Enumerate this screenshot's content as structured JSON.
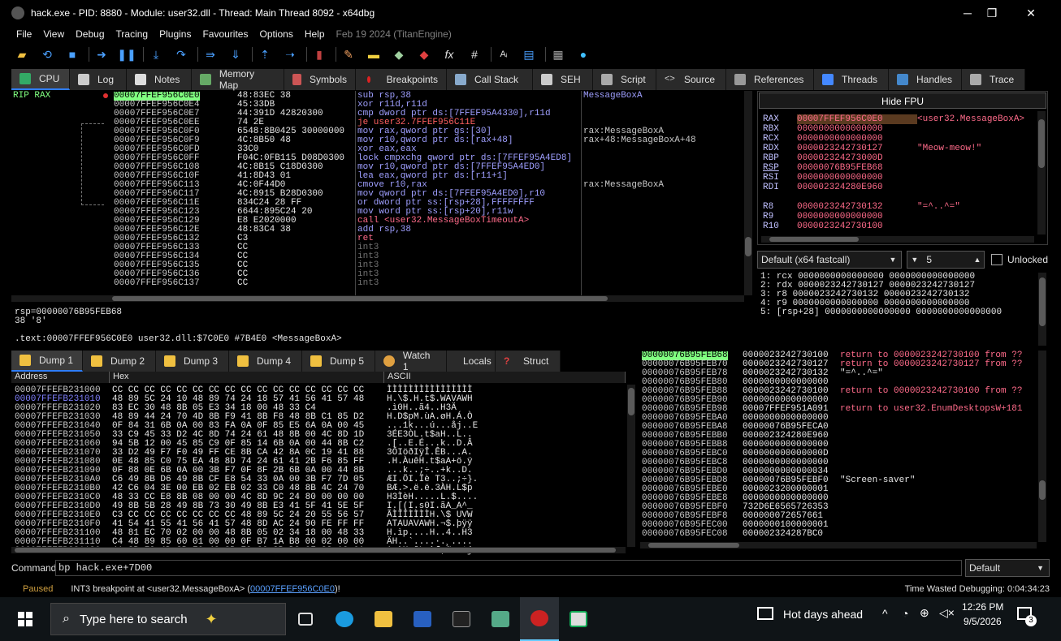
{
  "window": {
    "title": "hack.exe - PID: 8880 - Module: user32.dll - Thread: Main Thread 8092 - x64dbg",
    "minimize": "─",
    "maximize": "❐",
    "close": "✕"
  },
  "menu": [
    "File",
    "View",
    "Debug",
    "Tracing",
    "Plugins",
    "Favourites",
    "Options",
    "Help"
  ],
  "menu_date": "Feb 19 2024 (TitanEngine)",
  "toolbar_icons": [
    "open-icon",
    "restart-icon",
    "stop-icon",
    "run-icon",
    "pause-icon",
    "step-into-icon",
    "step-over-icon",
    "trace-into-icon",
    "trace-over-icon",
    "execute-till-return-icon",
    "run-to-user-code-icon",
    "patch-icon",
    "comment-icon",
    "label-icon",
    "bookmark-icon",
    "function-icon",
    "hash-icon",
    "font-icon",
    "settings-icon",
    "calculator-icon",
    "globe-icon"
  ],
  "tabs": [
    {
      "label": "CPU",
      "icon": "cpu-icon",
      "active": true
    },
    {
      "label": "Log",
      "icon": "log-icon"
    },
    {
      "label": "Notes",
      "icon": "notes-icon"
    },
    {
      "label": "Memory Map",
      "icon": "memory-map-icon"
    },
    {
      "label": "Symbols",
      "icon": "symbols-icon"
    },
    {
      "label": "Breakpoints",
      "icon": "breakpoints-icon"
    },
    {
      "label": "Call Stack",
      "icon": "call-stack-icon"
    },
    {
      "label": "SEH",
      "icon": "seh-icon"
    },
    {
      "label": "Script",
      "icon": "script-icon"
    },
    {
      "label": "Source",
      "icon": "source-icon"
    },
    {
      "label": "References",
      "icon": "references-icon"
    },
    {
      "label": "Threads",
      "icon": "threads-icon"
    },
    {
      "label": "Handles",
      "icon": "handles-icon"
    },
    {
      "label": "Trace",
      "icon": "trace-icon"
    }
  ],
  "disasm": {
    "rip_label": "RIP RAX",
    "rows": [
      {
        "addr": "00007FFEF956C0E0",
        "bytes": "48:83EC 38",
        "ins": "sub rsp,38",
        "cmt": "MessageBoxA",
        "current": true
      },
      {
        "addr": "00007FFEF956C0E4",
        "bytes": "45:33DB",
        "ins": "xor r11d,r11d",
        "cmt": ""
      },
      {
        "addr": "00007FFEF956C0E7",
        "bytes": "44:391D 42820300",
        "ins": "cmp dword ptr ds:[7FFEF95A4330],r11d",
        "cmt": ""
      },
      {
        "addr": "00007FFEF956C0EE",
        "bytes": "74 2E",
        "ins": "je user32.7FFEF956C11E",
        "cmt": "",
        "jmp": true
      },
      {
        "addr": "00007FFEF956C0F0",
        "bytes": "6548:8B0425 30000000",
        "ins": "mov rax,qword ptr gs:[30]",
        "cmt": "rax:MessageBoxA"
      },
      {
        "addr": "00007FFEF956C0F9",
        "bytes": "4C:8B50 48",
        "ins": "mov r10,qword ptr ds:[rax+48]",
        "cmt": "rax+48:MessageBoxA+48"
      },
      {
        "addr": "00007FFEF956C0FD",
        "bytes": "33C0",
        "ins": "xor eax,eax",
        "cmt": ""
      },
      {
        "addr": "00007FFEF956C0FF",
        "bytes": "F04C:0FB115 D08D0300",
        "ins": "lock cmpxchg qword ptr ds:[7FFEF95A4ED8]",
        "cmt": ""
      },
      {
        "addr": "00007FFEF956C108",
        "bytes": "4C:8B15 C18D0300",
        "ins": "mov r10,qword ptr ds:[7FFEF95A4ED0]",
        "cmt": ""
      },
      {
        "addr": "00007FFEF956C10F",
        "bytes": "41:8D43 01",
        "ins": "lea eax,qword ptr ds:[r11+1]",
        "cmt": ""
      },
      {
        "addr": "00007FFEF956C113",
        "bytes": "4C:0F44D0",
        "ins": "cmove r10,rax",
        "cmt": "rax:MessageBoxA"
      },
      {
        "addr": "00007FFEF956C117",
        "bytes": "4C:8915 B28D0300",
        "ins": "mov qword ptr ds:[7FFEF95A4ED0],r10",
        "cmt": ""
      },
      {
        "addr": "00007FFEF956C11E",
        "bytes": "834C24 28 FF",
        "ins": "or dword ptr ss:[rsp+28],FFFFFFFF",
        "cmt": ""
      },
      {
        "addr": "00007FFEF956C123",
        "bytes": "6644:895C24 20",
        "ins": "mov word ptr ss:[rsp+20],r11w",
        "cmt": ""
      },
      {
        "addr": "00007FFEF956C129",
        "bytes": "E8 E2020000",
        "ins": "call <user32.MessageBoxTimeoutA>",
        "cmt": "",
        "call": true
      },
      {
        "addr": "00007FFEF956C12E",
        "bytes": "48:83C4 38",
        "ins": "add rsp,38",
        "cmt": ""
      },
      {
        "addr": "00007FFEF956C132",
        "bytes": "C3",
        "ins": "ret",
        "cmt": "",
        "ret": true
      },
      {
        "addr": "00007FFEF956C133",
        "bytes": "CC",
        "ins": "int3",
        "cmt": "",
        "pad": true
      },
      {
        "addr": "00007FFEF956C134",
        "bytes": "CC",
        "ins": "int3",
        "cmt": "",
        "pad": true
      },
      {
        "addr": "00007FFEF956C135",
        "bytes": "CC",
        "ins": "int3",
        "cmt": "",
        "pad": true
      },
      {
        "addr": "00007FFEF956C136",
        "bytes": "CC",
        "ins": "int3",
        "cmt": "",
        "pad": true
      },
      {
        "addr": "00007FFEF956C137",
        "bytes": "CC",
        "ins": "int3",
        "cmt": "",
        "pad": true
      }
    ]
  },
  "info": {
    "line1": "rsp=00000076B95FEB68",
    "line2": "38 '8'",
    "line3": ".text:00007FFEF956C0E0 user32.dll:$7C0E0 #7B4E0 <MessageBoxA>"
  },
  "registers": {
    "hide_fpu": "Hide FPU",
    "rows": [
      {
        "name": "RAX",
        "value": "00007FFEF956C0E0",
        "cmt": "<user32.MessageBoxA>",
        "hl": true
      },
      {
        "name": "RBX",
        "value": "0000000000000000",
        "cmt": ""
      },
      {
        "name": "RCX",
        "value": "0000000000000000",
        "cmt": ""
      },
      {
        "name": "RDX",
        "value": "0000023242730127",
        "cmt": "\"Meow-meow!\""
      },
      {
        "name": "RBP",
        "value": "000002324273000D",
        "cmt": ""
      },
      {
        "name": "RSP",
        "value": "00000076B95FEB68",
        "cmt": ""
      },
      {
        "name": "RSI",
        "value": "0000000000000000",
        "cmt": ""
      },
      {
        "name": "RDI",
        "value": "000002324280E960",
        "cmt": ""
      },
      {
        "name": "R8",
        "value": "0000023242730132",
        "cmt": "\"=^..^=\""
      },
      {
        "name": "R9",
        "value": "0000000000000000",
        "cmt": ""
      },
      {
        "name": "R10",
        "value": "0000023242730100",
        "cmt": ""
      }
    ]
  },
  "callconv": {
    "convention": "Default (x64 fastcall)",
    "count": "5",
    "unlocked": "Unlocked"
  },
  "stack_args": [
    "1: rcx 0000000000000000 0000000000000000",
    "2: rdx 0000023242730127 0000023242730127",
    "3: r8 0000023242730132 0000023242730132",
    "4: r9 0000000000000000 0000000000000000",
    "5: [rsp+28] 0000000000000000 0000000000000000"
  ],
  "dump_tabs": [
    "Dump 1",
    "Dump 2",
    "Dump 3",
    "Dump 4",
    "Dump 5",
    "Watch 1",
    "Locals",
    "Struct"
  ],
  "dump": {
    "headers": [
      "Address",
      "Hex",
      "ASCII"
    ],
    "rows": [
      {
        "addr": "00007FFEFB231000",
        "hex": "CC CC CC CC CC CC CC CC CC CC CC CC CC CC CC CC",
        "ascii": "ÌÌÌÌÌÌÌÌÌÌÌÌÌÌÌÌ"
      },
      {
        "addr": "00007FFEFB231010",
        "hex": "48 89 5C 24 10 48 89 74 24 18 57 41 56 41 57 48",
        "ascii": "H.\\$.H.t$.WAVAWH"
      },
      {
        "addr": "00007FFEFB231020",
        "hex": "83 EC 30 48 8B 05 E3 34 18 00 48 33 C4",
        "ascii": ".ì0H..ã4..H3Ä"
      },
      {
        "addr": "00007FFEFB231030",
        "hex": "48 89 44 24 70 4D 8B F9 41 8B F8 48 8B C1 85 D2",
        "ascii": "H.D$pM.ùA.øH.Á.Ò"
      },
      {
        "addr": "00007FFEFB231040",
        "hex": "0F 84 31 6B 0A 00 83 FA 0A 0F 85 E5 6A 0A 00 45",
        "ascii": "...1k...ú...åj..E"
      },
      {
        "addr": "00007FFEFB231050",
        "hex": "33 C9 45 33 D2 4C 8D 74 24 61 48 8B 00 4C 8D 1D",
        "ascii": "3ÉE3ÒL.t$aH..L.."
      },
      {
        "addr": "00007FFEFB231060",
        "hex": "94 5B 12 00 45 85 C9 0F 85 14 6B 0A 00 44 8B C2",
        "ascii": ".[..E.É...k..D.Â"
      },
      {
        "addr": "00007FFEFB231070",
        "hex": "33 D2 49 F7 F0 49 FF CE 8B CA 42 8A 0C 19 41 88",
        "ascii": "3ÒIöðIÿÎ.ÊB...A."
      },
      {
        "addr": "00007FFEFB231080",
        "hex": "0E 48 85 C0 75 EA 48 8D 74 24 61 41 2B F6 85 FF",
        "ascii": ".H.ÀuêH.t$aA+ö.ÿ"
      },
      {
        "addr": "00007FFEFB231090",
        "hex": "0F 88 0E 6B 0A 00 3B F7 0F 8F 2B 6B 0A 00 44 8B",
        "ascii": "...k..;÷..+k..D."
      },
      {
        "addr": "00007FFEFB2310A0",
        "hex": "C6 49 8B D6 49 8B CF E8 54 33 0A 00 3B F7 7D 05",
        "ascii": "ÆI.ÖI.Ïè T3..;÷}."
      },
      {
        "addr": "00007FFEFB2310B0",
        "hex": "42 C6 04 3E 00 EB 02 EB 02 33 C0 48 8B 4C 24 70",
        "ascii": "BÆ.>.ë.ë.3ÀH.L$p"
      },
      {
        "addr": "00007FFEFB2310C0",
        "hex": "48 33 CC E8 8B 08 00 00 4C 8D 9C 24 80 00 00 00",
        "ascii": "H3ÌèH.....L.$...."
      },
      {
        "addr": "00007FFEFB2310D0",
        "hex": "49 8B 5B 28 49 8B 73 30 49 8B E3 41 5F 41 5E 5F",
        "ascii": "I.[(I.s0I.ãA_A^_"
      },
      {
        "addr": "00007FFEFB2310E0",
        "hex": "C3 CC CC CC CC CC CC CC 48 89 5C 24 20 55 56 57",
        "ascii": "ÃÌÌÌÌÌÌÌH.\\$ UVW"
      },
      {
        "addr": "00007FFEFB2310F0",
        "hex": "41 54 41 55 41 56 41 57 48 8D AC 24 90 FE FF FF",
        "ascii": "ATAUAVAWH.¬$.þÿÿ"
      },
      {
        "addr": "00007FFEFB231100",
        "hex": "48 81 EC 70 02 00 00 48 8B 05 02 34 18 00 48 33",
        "ascii": "H.ìp....H..4..H3"
      },
      {
        "addr": "00007FFEFB231110",
        "hex": "C4 48 89 85 60 01 00 00 0F B7 1A B8 00 02 00 00",
        "ascii": "ÄH..`....·.¸...."
      },
      {
        "addr": "00007FFEFB231120",
        "hex": "41 8B F9 4D 8B F0 4C 8B F9 66 3B D8 0F 83 A2 6A",
        "ascii": "A.ùM.ðL.ùf;Ø..¢j"
      }
    ]
  },
  "stack": {
    "rows": [
      {
        "addr": "00000076B95FEB68",
        "val": "0000023242730100",
        "cmt": "return to 0000023242730100 from ??",
        "cur": true
      },
      {
        "addr": "00000076B95FEB70",
        "val": "0000023242730127",
        "cmt": "return to 0000023242730127 from ??"
      },
      {
        "addr": "00000076B95FEB78",
        "val": "0000023242730132",
        "cmt": "\"=^..^=\"",
        "str": true
      },
      {
        "addr": "00000076B95FEB80",
        "val": "0000000000000000",
        "cmt": ""
      },
      {
        "addr": "00000076B95FEB88",
        "val": "0000023242730100",
        "cmt": "return to 0000023242730100 from ??"
      },
      {
        "addr": "00000076B95FEB90",
        "val": "0000000000000000",
        "cmt": ""
      },
      {
        "addr": "00000076B95FEB98",
        "val": "00007FFEF951A091",
        "cmt": "return to user32.EnumDesktopsW+181"
      },
      {
        "addr": "00000076B95FEBA0",
        "val": "0000000000000000",
        "cmt": ""
      },
      {
        "addr": "00000076B95FEBA8",
        "val": "00000076B95FECA0",
        "cmt": ""
      },
      {
        "addr": "00000076B95FEBB0",
        "val": "000002324280E960",
        "cmt": ""
      },
      {
        "addr": "00000076B95FEBB8",
        "val": "0000000000000000",
        "cmt": ""
      },
      {
        "addr": "00000076B95FEBC0",
        "val": "000000000000000D",
        "cmt": ""
      },
      {
        "addr": "00000076B95FEBC8",
        "val": "0000000000000000",
        "cmt": ""
      },
      {
        "addr": "00000076B95FEBD0",
        "val": "0000000000000034",
        "cmt": ""
      },
      {
        "addr": "00000076B95FEBD8",
        "val": "00000076B95FEBF0",
        "cmt": "\"Screen-saver\"",
        "str": true
      },
      {
        "addr": "00000076B95FEBE0",
        "val": "0000023200000001",
        "cmt": ""
      },
      {
        "addr": "00000076B95FEBE8",
        "val": "0000000000000000",
        "cmt": ""
      },
      {
        "addr": "00000076B95FEBF0",
        "val": "732D6E6565726353",
        "cmt": ""
      },
      {
        "addr": "00000076B95FEBF8",
        "val": "000000072657661",
        "cmt": ""
      },
      {
        "addr": "00000076B95FEC00",
        "val": "0000000100000001",
        "cmt": ""
      },
      {
        "addr": "00000076B95FEC08",
        "val": "000002324287BC0",
        "cmt": ""
      }
    ]
  },
  "command": {
    "label": "Command:",
    "value": "bp hack.exe+7D00",
    "mode": "Default"
  },
  "status": {
    "state": "Paused",
    "message": "INT3 breakpoint at <user32.MessageBoxA> (",
    "link": "00007FFEF956C0E0",
    "tail": ")!",
    "time": "Time Wasted Debugging: 0:04:34:23"
  },
  "taskbar": {
    "search_placeholder": "Type here to search",
    "weather": "Hot days ahead",
    "time": "12:26 PM",
    "date": "9/5/2026",
    "notif": "3"
  },
  "colors": {
    "accent": "#2e7dff",
    "current_row": "#80ff80",
    "register_value": "#ff6b8a",
    "instruction": "#9f9fff"
  }
}
